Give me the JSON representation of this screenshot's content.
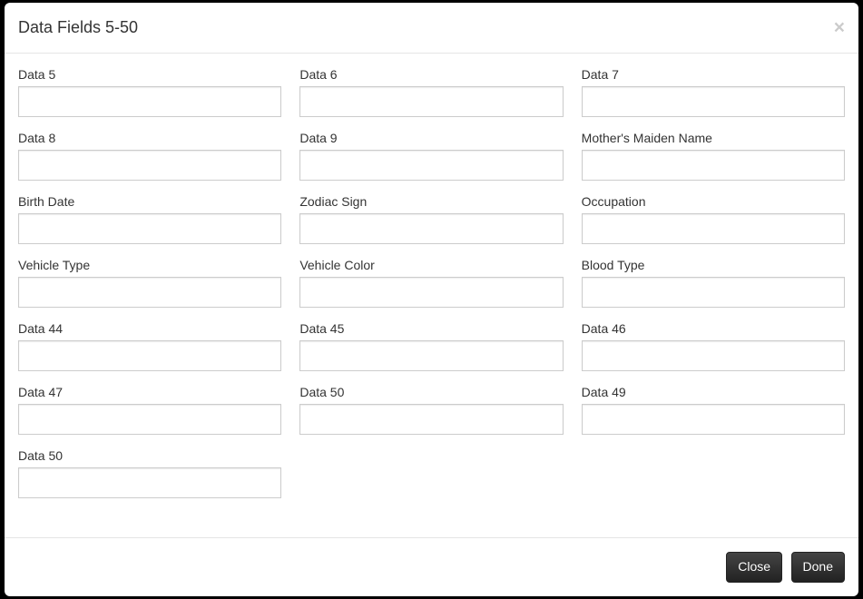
{
  "modal": {
    "title": "Data Fields 5-50",
    "close_icon": "×"
  },
  "fields": [
    {
      "label": "Data 5",
      "value": ""
    },
    {
      "label": "Data 6",
      "value": ""
    },
    {
      "label": "Data 7",
      "value": ""
    },
    {
      "label": "Data 8",
      "value": ""
    },
    {
      "label": "Data 9",
      "value": ""
    },
    {
      "label": "Mother's Maiden Name",
      "value": ""
    },
    {
      "label": "Birth Date",
      "value": ""
    },
    {
      "label": "Zodiac Sign",
      "value": ""
    },
    {
      "label": "Occupation",
      "value": ""
    },
    {
      "label": "Vehicle Type",
      "value": ""
    },
    {
      "label": "Vehicle Color",
      "value": ""
    },
    {
      "label": "Blood Type",
      "value": ""
    },
    {
      "label": "Data 44",
      "value": ""
    },
    {
      "label": "Data 45",
      "value": ""
    },
    {
      "label": "Data 46",
      "value": ""
    },
    {
      "label": "Data 47",
      "value": ""
    },
    {
      "label": "Data 50",
      "value": ""
    },
    {
      "label": "Data 49",
      "value": ""
    },
    {
      "label": "Data 50",
      "value": ""
    }
  ],
  "footer": {
    "close_label": "Close",
    "done_label": "Done"
  }
}
